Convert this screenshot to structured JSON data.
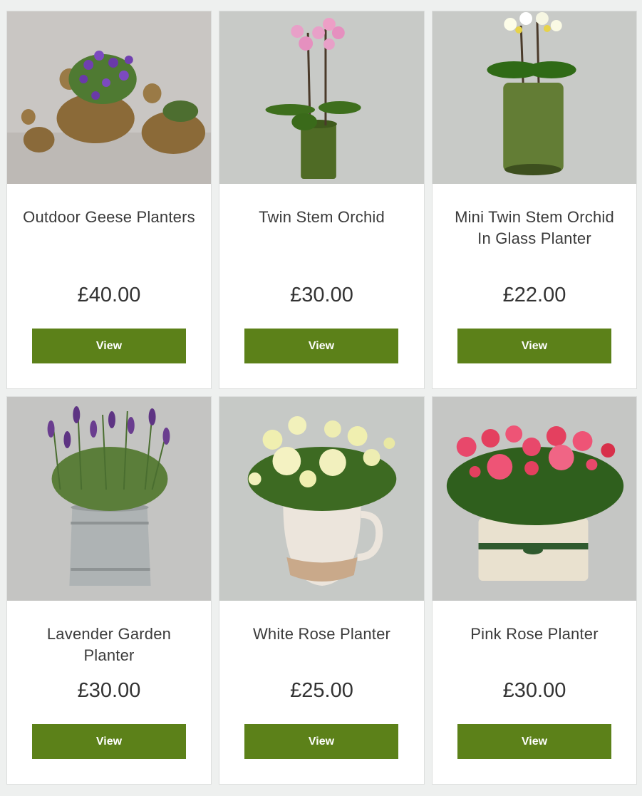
{
  "products": [
    {
      "title": "Outdoor Geese Planters",
      "price": "£40.00",
      "button": "View"
    },
    {
      "title": "Twin Stem Orchid",
      "price": "£30.00",
      "button": "View"
    },
    {
      "title": "Mini Twin Stem Orchid In Glass Planter",
      "price": "£22.00",
      "button": "View"
    },
    {
      "title": "Lavender Garden Planter",
      "price": "£30.00",
      "button": "View"
    },
    {
      "title": "White Rose Planter",
      "price": "£25.00",
      "button": "View"
    },
    {
      "title": "Pink Rose Planter",
      "price": "£30.00",
      "button": "View"
    }
  ],
  "colors": {
    "button_bg": "#5c8119",
    "page_bg": "#eef0ef",
    "card_bg": "#ffffff"
  }
}
